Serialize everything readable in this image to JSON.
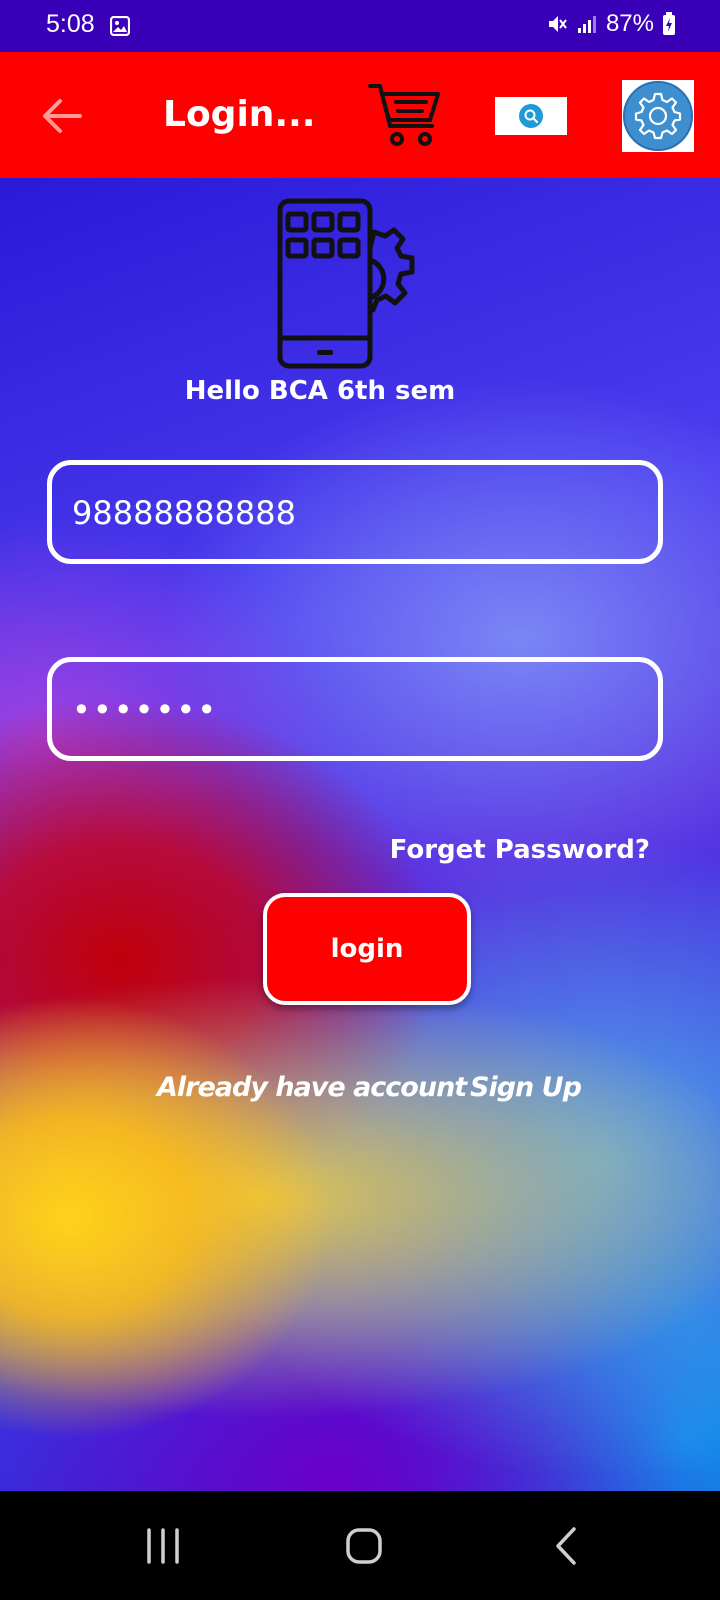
{
  "status_bar": {
    "time": "5:08",
    "battery": "87%",
    "icons": [
      "gallery-icon",
      "mute-icon",
      "signal-icon",
      "battery-charging-icon"
    ]
  },
  "app_bar": {
    "title": "Login...",
    "icons": [
      "back-arrow-icon",
      "cart-icon",
      "search-icon",
      "settings-gear-icon"
    ],
    "background": "#ff0000"
  },
  "login_form": {
    "greeting": "Hello BCA 6th sem",
    "phone_value": "98888888888",
    "password_value": "•••••••",
    "forget_password": "Forget Password?",
    "login_button": "login",
    "already_account": "Already have account",
    "sign_up": "Sign Up"
  },
  "navigation_bar": {
    "icons": [
      "recents-icon",
      "home-icon",
      "back-icon"
    ]
  },
  "colors": {
    "status_bar": "#3a00b8",
    "accent": "#ff0000",
    "text": "#ffffff"
  }
}
